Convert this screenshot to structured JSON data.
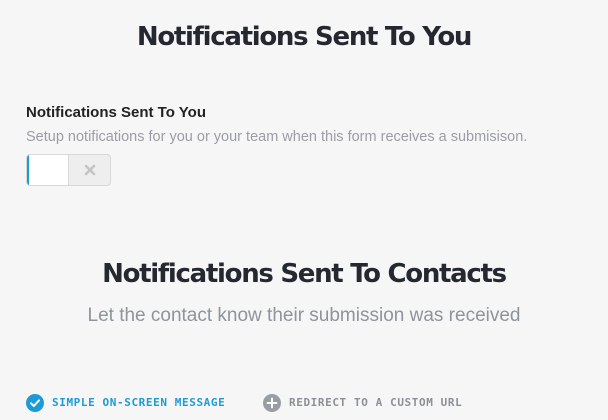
{
  "page_title": "Notifications Sent To You",
  "you_section": {
    "label": "Notifications Sent To You",
    "description": "Setup notifications for you or your team when this form receives a submisison.",
    "toggle_state": "off"
  },
  "contacts_section": {
    "title": "Notifications Sent To Contacts",
    "description": "Let the contact know their submission was received"
  },
  "options": {
    "simple_message": {
      "label": "SIMPLE ON-SCREEN MESSAGE",
      "selected": true,
      "icon": "check-circle-icon"
    },
    "redirect_url": {
      "label": "REDIRECT TO A CUSTOM URL",
      "selected": false,
      "icon": "plus-circle-icon"
    }
  },
  "colors": {
    "accent": "#1e9bd7",
    "heading": "#252831",
    "muted": "#9a9ea4",
    "inactive_option": "#8c9096",
    "background": "#f6f6f6"
  }
}
